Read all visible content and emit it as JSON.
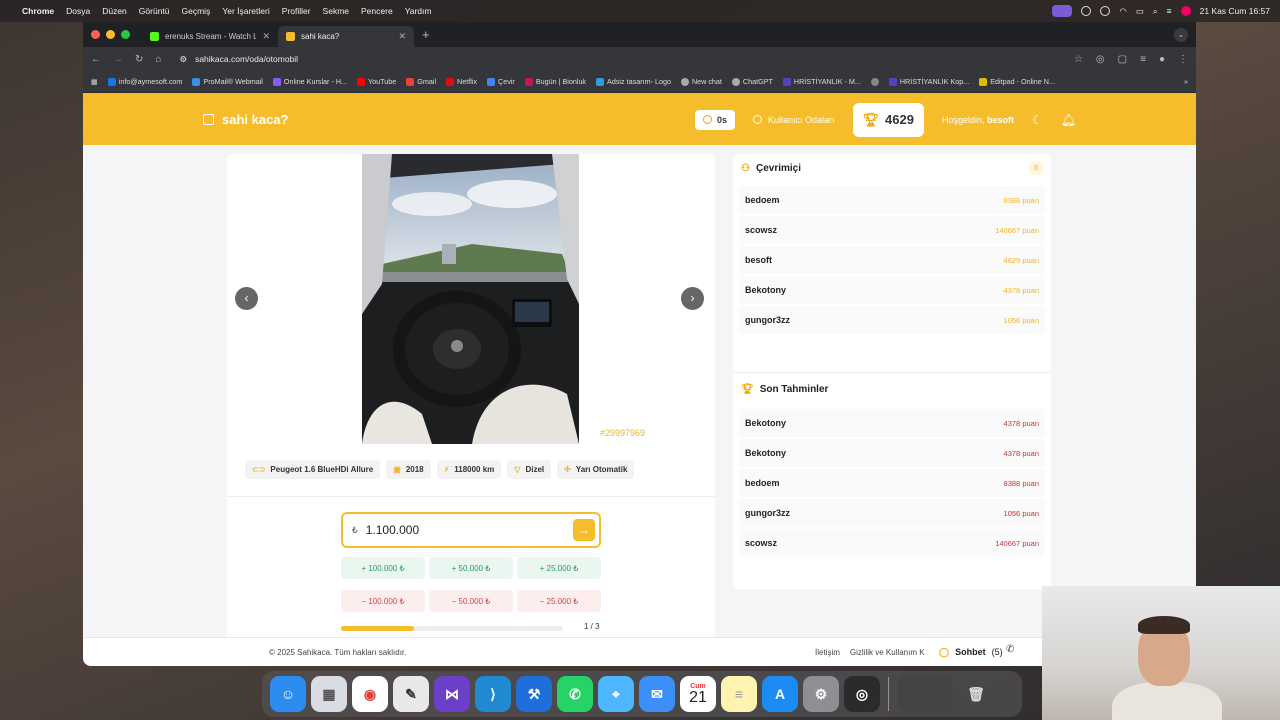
{
  "menubar": {
    "items": [
      "Chrome",
      "Dosya",
      "Düzen",
      "Görüntü",
      "Geçmiş",
      "Yer İşaretleri",
      "Profiller",
      "Sekme",
      "Pencere",
      "Yardım"
    ],
    "clock": "21 Kas Cum 16:57"
  },
  "browser": {
    "tabs": [
      {
        "title": "erenuks Stream - Watch Live",
        "active": false
      },
      {
        "title": "sahi kaca?",
        "active": true
      }
    ],
    "url": "sahikaca.com/oda/otomobil",
    "bookmarks": [
      "info@aymesoft.com",
      "ProMail® Webmail",
      "Online Kurslar - H...",
      "YouTube",
      "Gmail",
      "Netflix",
      "Çevir",
      "Bugün | Bionluk",
      "Adsiz tasarım- Logo",
      "New chat",
      "ChatGPT",
      "HRİSTİYANLIK - M...",
      "",
      "HRİSTİYANLIK Kop...",
      "Editpad - Online N..."
    ]
  },
  "header": {
    "logo": "sahi kaca?",
    "timer": "0s",
    "rooms_label": "Kullanıcı Odaları",
    "score": "4629",
    "welcome_prefix": "Hoşgeldin,",
    "username": "besoft"
  },
  "listing": {
    "id": "#29997969",
    "chips": [
      "Peugeot 1.6 BlueHDi Allure",
      "2018",
      "118000 km",
      "Dizel",
      "Yarı Otomatik"
    ],
    "price_currency": "₺",
    "price_value": "1.100.000",
    "plus_buttons": [
      "+ 100.000 ₺",
      "+ 50.000 ₺",
      "+ 25.000 ₺"
    ],
    "minus_buttons": [
      "− 100.000 ₺",
      "− 50.000 ₺",
      "− 25.000 ₺"
    ],
    "progress": 0.33,
    "page": "1 / 3"
  },
  "online": {
    "title": "Çevrimiçi",
    "count": "5",
    "users": [
      {
        "name": "bedoem",
        "points": "8388 puan"
      },
      {
        "name": "scowsz",
        "points": "140667 puan"
      },
      {
        "name": "besoft",
        "points": "4629 puan"
      },
      {
        "name": "Bekotony",
        "points": "4378 puan"
      },
      {
        "name": "gungor3zz",
        "points": "1056 puan"
      }
    ]
  },
  "recent": {
    "title": "Son Tahminler",
    "items": [
      {
        "name": "Bekotony",
        "points": "4378 puan"
      },
      {
        "name": "Bekotony",
        "points": "4378 puan"
      },
      {
        "name": "bedoem",
        "points": "8388 puan"
      },
      {
        "name": "gungor3zz",
        "points": "1056 puan"
      },
      {
        "name": "scowsz",
        "points": "140667 puan"
      }
    ]
  },
  "footer": {
    "copyright": "© 2025 Sahikaca. Tüm hakları saklıdır.",
    "links": [
      "İletişim",
      "Gizlilik ve Kullanım K"
    ],
    "chat_label": "Sohbet",
    "chat_count": "(5)"
  },
  "dock": {
    "calendar_month": "Cum",
    "calendar_day": "21"
  },
  "colors": {
    "brand": "#f5bd2c",
    "points_yellow": "#f0b32c",
    "points_red": "#c63434"
  }
}
